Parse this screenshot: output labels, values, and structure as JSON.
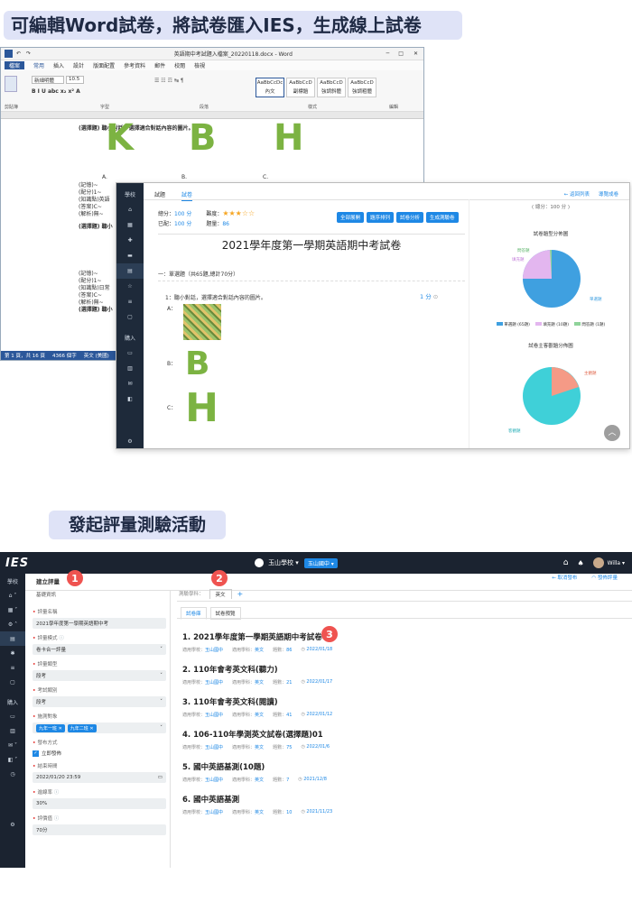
{
  "heading1": "可編輯Word試卷，將試卷匯入IES，生成線上試卷",
  "heading2": "發起評量測驗活動",
  "word": {
    "title": "英語期中考試題入檔案_20220118.docx - Word",
    "menus": [
      "檔案",
      "常用",
      "插入",
      "設計",
      "版面配置",
      "參考資料",
      "郵件",
      "校閱",
      "檢視"
    ],
    "font_name": "新細明體",
    "font_size": "10.5",
    "styles": [
      "AaBbCcDc",
      "AaBbCcD",
      "AaBbCcD",
      "AaBbCcD"
    ],
    "style_names": [
      "內文",
      "副標題",
      "強調斜體",
      "強調粗體"
    ],
    "groups": [
      "剪貼簿",
      "字型",
      "段落",
      "樣式",
      "編輯"
    ],
    "doc_lines": [
      "(選擇題) 聽小對話，選擇適合對話內容的圖片。",
      "(記憶)~",
      "(配分)1~",
      "(知識點)英語",
      "(答案)C~",
      "(解析)無~",
      "(選擇題) 聽小",
      "(記憶)~",
      "(配分)1~",
      "(知識點)日常",
      "(答案)C~",
      "(解析)無~",
      "(選擇題) 聽小"
    ],
    "option_labels": [
      "A.",
      "B.",
      "C."
    ],
    "status": [
      "第 1 頁，共 16 頁",
      "4366 個字",
      "英文 (美國)"
    ]
  },
  "ies": {
    "tabs": [
      "試題",
      "試卷"
    ],
    "back_link": "← 返回列表",
    "sheet_link": "導覽成卷",
    "score_label": "總分：",
    "score_value": "100 分",
    "difficulty_label": "難度：",
    "added_label": "已配：",
    "added_value": "100 分",
    "count_label": "題量：",
    "count_value": "86",
    "rating": 3,
    "buttons": [
      "全部展開",
      "題序排列",
      "試卷分析",
      "生成測驗卷"
    ],
    "exam_title": "2021學年度第一學期英語期中考試卷",
    "section": "一：單選題（共65題,總計70分）",
    "question": "1：聽小對話，選擇適合對話內容的圖片。",
    "q_score": "1 分",
    "options": [
      "A：",
      "B：",
      "C："
    ],
    "right_total": "( 總分：100 分 )",
    "chart1_title": "試卷題型分佈圖",
    "chart1_labels": [
      "單選題",
      "填充題",
      "問答題"
    ],
    "chart1_legend": [
      "單選題 (65題)",
      "填充題 (10題)",
      "問答題 (1題)"
    ],
    "chart2_title": "試卷主客觀題分佈圖",
    "chart2_labels": [
      "主觀題",
      "客觀題"
    ],
    "colors": {
      "pie_blue": "#3fa0e0",
      "pie_pink": "#e3b6ef",
      "pie_green": "#8fd39a",
      "pie_teal": "#3fd0d8",
      "pie_salmon": "#f59a86"
    }
  },
  "app": {
    "logo": "IES",
    "school": "玉山學校",
    "school_tag": "玉山國中",
    "user": "Willa",
    "page_title": "建立評量",
    "basic_info": "基礎資訊",
    "subject_label": "測驗學科：",
    "subject_value": "英文",
    "tabs": [
      "試卷庫",
      "試卷預覽"
    ],
    "cancel_link": "← 取消發布",
    "publish_link": "發佈評量",
    "badges": [
      "1",
      "2",
      "3"
    ],
    "form": [
      {
        "label": "評量名稱",
        "value": "2021學年度第一學期英語期中考"
      },
      {
        "label": "評量模式",
        "value": "卷卡合一評量"
      },
      {
        "label": "評量類型",
        "value": "段考"
      },
      {
        "label": "考試類別",
        "value": "段考"
      },
      {
        "label": "施測對象",
        "value": ""
      },
      {
        "label": "發布方式",
        "value": "立即發佈"
      },
      {
        "label": "結束時間",
        "value": "2022/01/20 23:59"
      },
      {
        "label": "進線率",
        "value": "30%"
      },
      {
        "label": "評價值",
        "value": "70分"
      }
    ],
    "target_tags": [
      "九年一班",
      "九年二班"
    ],
    "sidebar_labels": [
      "學校",
      "購入"
    ],
    "exams": [
      {
        "title": "1. 2021學年度第一學期英語期中考試卷",
        "school": "玉山國中",
        "subject": "英文",
        "count": "86",
        "date": "2022/01/18"
      },
      {
        "title": "2. 110年會考英文科(聽力)",
        "school": "玉山國中",
        "subject": "英文",
        "count": "21",
        "date": "2022/01/17"
      },
      {
        "title": "3. 110年會考英文科(閱讀)",
        "school": "玉山國中",
        "subject": "英文",
        "count": "41",
        "date": "2022/01/12"
      },
      {
        "title": "4. 106-110年學測英文試卷(選擇題)01",
        "school": "玉山國中",
        "subject": "英文",
        "count": "75",
        "date": "2022/01/6"
      },
      {
        "title": "5. 國中英語基測(10題)",
        "school": "玉山國中",
        "subject": "英文",
        "count": "7",
        "date": "2021/12/8"
      },
      {
        "title": "6. 國中英語基測",
        "school": "玉山國中",
        "subject": "英文",
        "count": "10",
        "date": "2021/11/23"
      }
    ],
    "meta_labels": {
      "school": "適用學校：",
      "subject": "適用學科：",
      "count": "題數："
    }
  }
}
